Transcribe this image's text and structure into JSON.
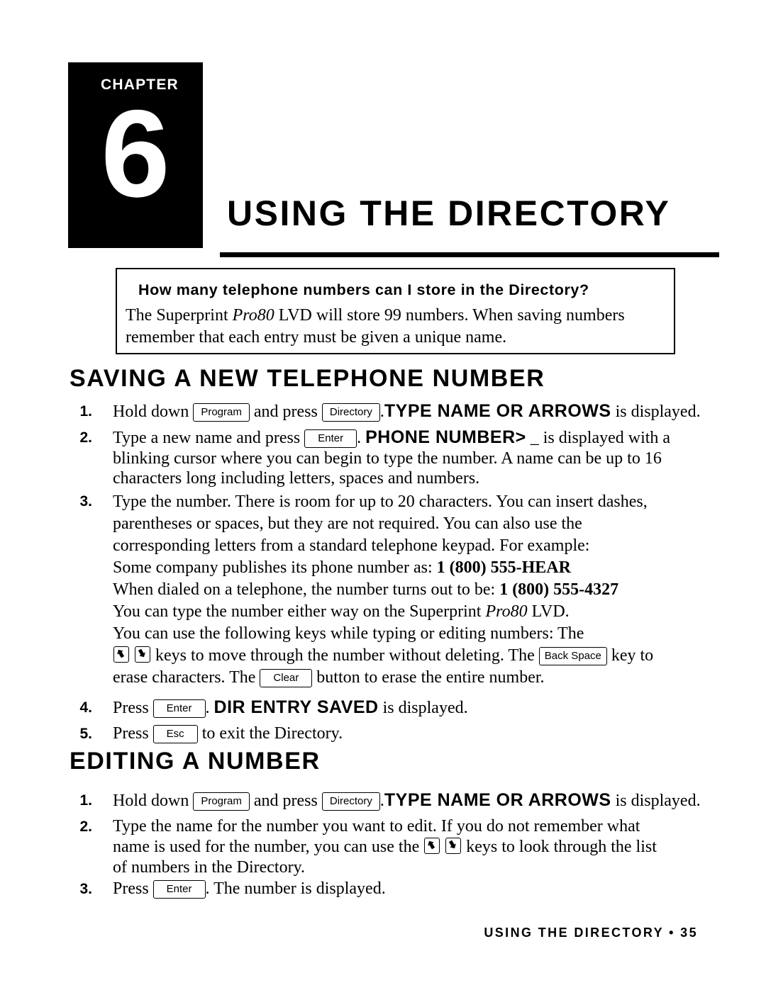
{
  "chapter": {
    "label": "CHAPTER",
    "number": "6"
  },
  "title": "USING THE DIRECTORY",
  "faq": {
    "question": "How many telephone numbers can I store in the Directory?",
    "answer_1": "The Superprint ",
    "answer_italic": "Pro80",
    "answer_2": " LVD will store 99 numbers. When saving numbers",
    "answer_3": "remember that each entry must be given a unique name."
  },
  "sections": [
    {
      "heading": "SAVING A NEW TELEPHONE NUMBER",
      "steps": [
        {
          "num": "1."
        },
        {
          "num": "2."
        },
        {
          "num": "3."
        },
        {
          "num": "4."
        },
        {
          "num": "5."
        }
      ]
    },
    {
      "heading": "EDITING A NUMBER",
      "steps": [
        {
          "num": "1."
        },
        {
          "num": "2."
        },
        {
          "num": "3."
        }
      ]
    }
  ],
  "keys": {
    "program": "Program",
    "directory": "Directory",
    "enter": "Enter",
    "back_space": "Back Space",
    "clear": "Clear",
    "esc": "Esc"
  },
  "display_text": {
    "type_name_or_arrows": "TYPE NAME OR ARROWS",
    "phone_number": "PHONE NUMBER>",
    "dir_entry_saved": "DIR ENTRY SAVED"
  },
  "saving_steps_text": {
    "s1_a": "Hold down",
    "s1_b": "and press",
    "s1_c": ".",
    "s1_d": "is displayed.",
    "s2_a": "Type a new name and press",
    "s2_b": ".",
    "s2_c": "_ is displayed with a",
    "s2_line2": "blinking cursor where you can begin to type the number. A name can be up to 16",
    "s2_line3": "characters long including letters, spaces and numbers.",
    "s3_line1": "Type the number. There is room for up to 20 characters. You can insert dashes,",
    "s3_line2": "parentheses or spaces, but they are not required. You can also use the",
    "s3_line3": "corresponding letters from a standard telephone keypad. For example:",
    "s3_line4_a": "Some company publishes its phone number as: ",
    "s3_line4_b": "1 (800) 555-HEAR",
    "s3_line5_a": "When dialed on a telephone, the number turns out to be: ",
    "s3_line5_b": "1 (800) 555-4327",
    "s3_line6_a": "You can type the number either way on the Superprint ",
    "s3_line6_i": "Pro80",
    "s3_line6_b": " LVD.",
    "s3_line7": "You can use the following keys while typing or editing numbers: The",
    "s3_line8_a": "keys to move through the number without deleting. The",
    "s3_line8_b": "key to",
    "s3_line9_a": "erase characters. The",
    "s3_line9_b": "button to erase the entire number.",
    "s4_a": "Press",
    "s4_b": ".",
    "s4_c": "is displayed.",
    "s5_a": "Press",
    "s5_b": "to exit the Directory."
  },
  "editing_steps_text": {
    "e1_a": "Hold down",
    "e1_b": "and press",
    "e1_c": ".",
    "e1_d": "is displayed.",
    "e2_line1": "Type the name for the number you want to edit. If you do not remember what",
    "e2_line2_a": "name is used for the number, you can use the",
    "e2_line2_b": "keys to look through the list",
    "e2_line3": "of numbers in the Directory.",
    "e3_a": "Press",
    "e3_b": ". The number is displayed."
  },
  "footer": "USING THE DIRECTORY • 35"
}
